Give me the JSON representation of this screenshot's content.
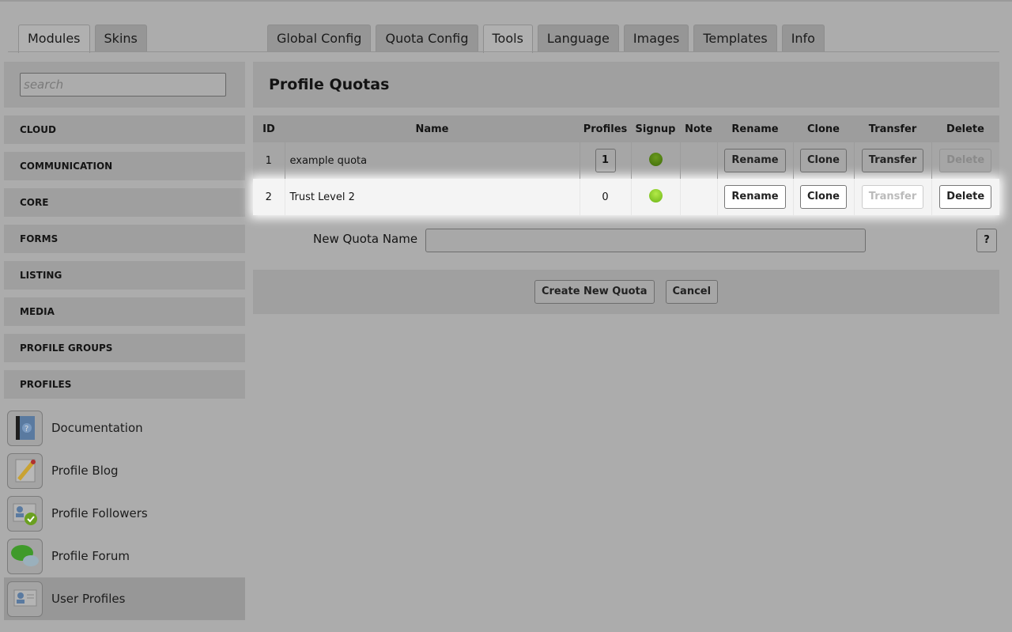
{
  "left_tabs": [
    {
      "label": "Modules",
      "active": true
    },
    {
      "label": "Skins",
      "active": false
    }
  ],
  "main_tabs": [
    {
      "label": "Global Config",
      "active": false
    },
    {
      "label": "Quota Config",
      "active": false
    },
    {
      "label": "Tools",
      "active": true
    },
    {
      "label": "Language",
      "active": false
    },
    {
      "label": "Images",
      "active": false
    },
    {
      "label": "Templates",
      "active": false
    },
    {
      "label": "Info",
      "active": false
    }
  ],
  "search": {
    "placeholder": "search",
    "value": ""
  },
  "categories": [
    "CLOUD",
    "COMMUNICATION",
    "CORE",
    "FORMS",
    "LISTING",
    "MEDIA",
    "PROFILE GROUPS",
    "PROFILES"
  ],
  "modules": [
    {
      "label": "Documentation",
      "icon": "book-help-icon"
    },
    {
      "label": "Profile Blog",
      "icon": "pencil-icon"
    },
    {
      "label": "Profile Followers",
      "icon": "profile-check-icon"
    },
    {
      "label": "Profile Forum",
      "icon": "chat-bubbles-icon"
    },
    {
      "label": "User Profiles",
      "icon": "profile-card-icon",
      "selected": true
    }
  ],
  "page_title": "Profile Quotas",
  "table": {
    "headers": [
      "ID",
      "Name",
      "Profiles",
      "Signup",
      "Note",
      "Rename",
      "Clone",
      "Transfer",
      "Delete"
    ],
    "rows": [
      {
        "id": "1",
        "name": "example quota",
        "profiles": "1",
        "signup": "active",
        "rename": "Rename",
        "clone": "Clone",
        "transfer": "Transfer",
        "delete": "Delete",
        "transfer_disabled": false,
        "delete_disabled": true
      },
      {
        "id": "2",
        "name": "Trust Level 2",
        "profiles": "0",
        "signup": "active",
        "rename": "Rename",
        "clone": "Clone",
        "transfer": "Transfer",
        "delete": "Delete",
        "transfer_disabled": true,
        "delete_disabled": false
      }
    ]
  },
  "new_quota": {
    "label": "New Quota Name",
    "value": "",
    "help": "?"
  },
  "buttons": {
    "create": "Create New Quota",
    "cancel": "Cancel"
  }
}
